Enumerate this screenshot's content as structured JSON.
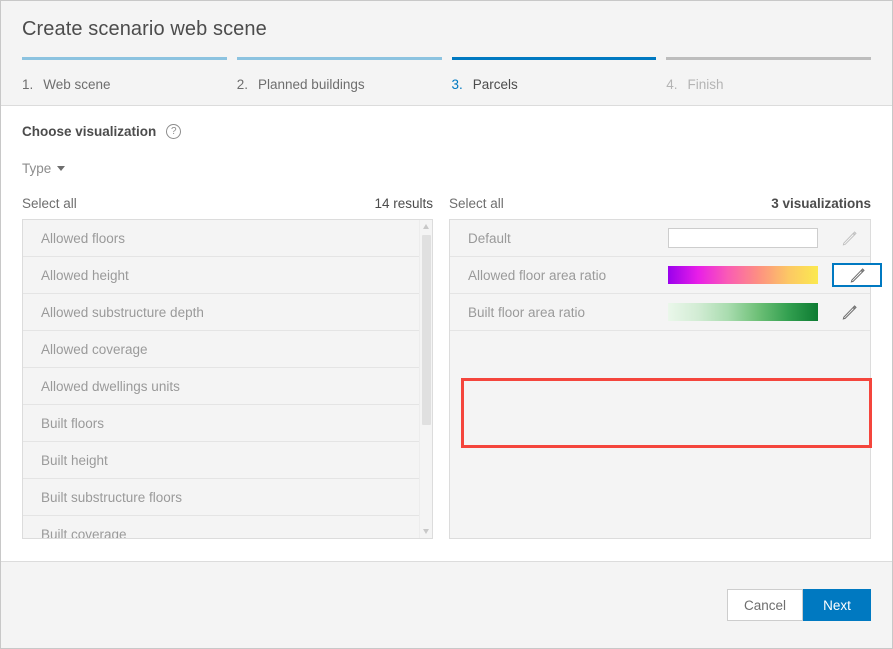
{
  "window": {
    "title": "Create scenario web scene"
  },
  "steps": [
    {
      "num": "1.",
      "label": "Web scene",
      "state": "done"
    },
    {
      "num": "2.",
      "label": "Planned buildings",
      "state": "done"
    },
    {
      "num": "3.",
      "label": "Parcels",
      "state": "current"
    },
    {
      "num": "4.",
      "label": "Finish",
      "state": "inactive"
    }
  ],
  "section": {
    "title": "Choose visualization",
    "help_icon": "help-circle-icon"
  },
  "type_filter": {
    "label": "Type",
    "caret_icon": "chevron-down-icon"
  },
  "attributes_panel": {
    "select_all": "Select all",
    "count": "14 results",
    "items": [
      "Allowed floors",
      "Allowed height",
      "Allowed substructure depth",
      "Allowed coverage",
      "Allowed dwellings units",
      "Built floors",
      "Built height",
      "Built substructure floors",
      "Built coverage"
    ],
    "scrollbar": {
      "up_icon": "scroll-up-arrow-icon",
      "down_icon": "scroll-down-arrow-icon"
    }
  },
  "visualizations_panel": {
    "select_all": "Select all",
    "count": "3 visualizations",
    "rows": [
      {
        "name": "Default",
        "swatch_type": "input",
        "input_value": "",
        "pencil_icon": "edit-pencil-icon",
        "selected": false
      },
      {
        "name": "Allowed floor area ratio",
        "swatch_type": "ramp",
        "ramp": [
          "#9a00ec",
          "#e81ee8",
          "#fa5cb4",
          "#fd8f82",
          "#fcc765",
          "#fbe94f"
        ],
        "pencil_icon": "edit-pencil-icon",
        "selected": true
      },
      {
        "name": "Built floor area ratio",
        "swatch_type": "ramp",
        "ramp": [
          "#eaf7ea",
          "#d2ecd4",
          "#a9dcaf",
          "#6ec077",
          "#33a050",
          "#0d7b32"
        ],
        "pencil_icon": "edit-pencil-icon",
        "selected": false
      }
    ]
  },
  "annotation": {
    "highlight_color": "#f4453c"
  },
  "footer": {
    "cancel_label": "Cancel",
    "next_label": "Next"
  },
  "colors": {
    "accent_blue": "#0079c1",
    "step_done_blue": "#8cc3e0",
    "panel_bg": "#f4f4f4"
  }
}
